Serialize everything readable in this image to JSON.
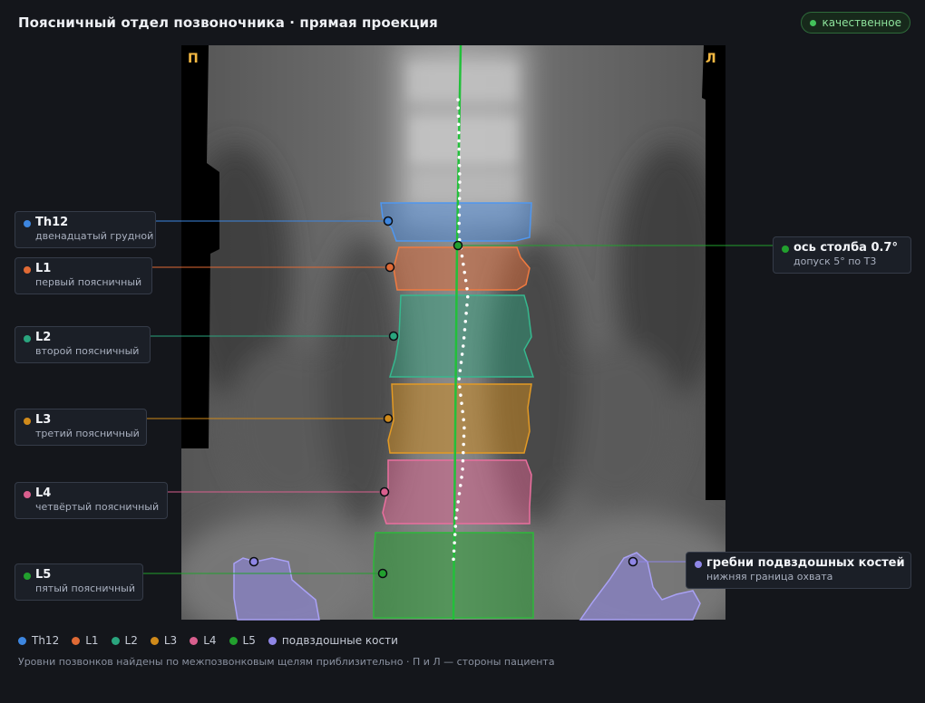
{
  "header": {
    "title": "Поясничный отдел позвоночника · прямая проекция",
    "badge": "качественное"
  },
  "image": {
    "side_left": "П",
    "side_right": "Л"
  },
  "colors": {
    "Th12": "#3d86e0",
    "L1": "#e06a35",
    "L2": "#2aa57e",
    "L3": "#d08a1a",
    "L4": "#d95f8e",
    "L5": "#22a02e",
    "iliac": "#8f86e6",
    "axis": "#22c03a"
  },
  "labels": {
    "th12": {
      "name": "Th12",
      "sub": "двенадцатый грудной"
    },
    "l1": {
      "name": "L1",
      "sub": "первый поясничный"
    },
    "l2": {
      "name": "L2",
      "sub": "второй поясничный"
    },
    "l3": {
      "name": "L3",
      "sub": "третий поясничный"
    },
    "l4": {
      "name": "L4",
      "sub": "четвёртый поясничный"
    },
    "l5": {
      "name": "L5",
      "sub": "пятый поясничный"
    },
    "axis": {
      "name": "ось столба 0.7°",
      "sub": "допуск 5° по Т3"
    },
    "iliac": {
      "name": "гребни подвздошных костей",
      "sub": "нижняя граница охвата"
    }
  },
  "legend": [
    "Th12",
    "L1",
    "L2",
    "L3",
    "L4",
    "L5",
    "подвздошные кости"
  ],
  "footnote": "Уровни позвонков найдены по межпозвонковым щелям приблизительно · П и Л — стороны пациента"
}
